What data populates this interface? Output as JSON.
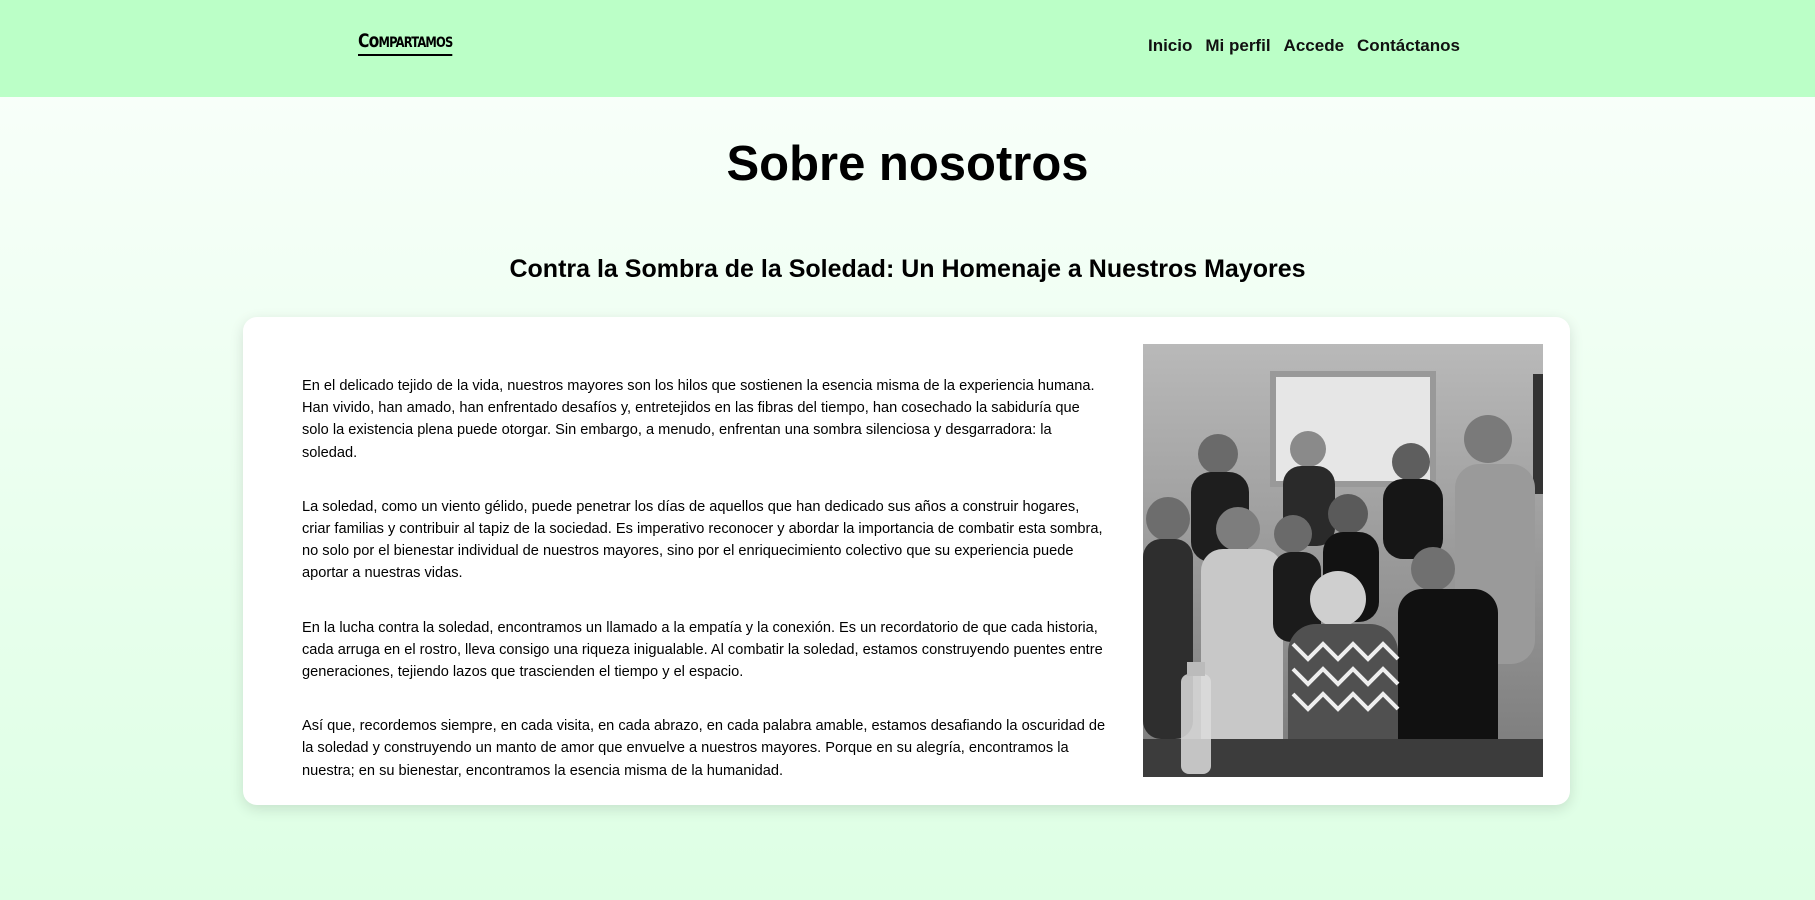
{
  "header": {
    "logo": {
      "big": "Co",
      "rest": "MPARTAMOS"
    },
    "nav": [
      {
        "label": "Inicio"
      },
      {
        "label": "Mi perfil"
      },
      {
        "label": "Accede"
      },
      {
        "label": "Contáctanos"
      }
    ],
    "background": "#bbffc7"
  },
  "main": {
    "title": "Sobre nosotros",
    "subtitle": "Contra la Sombra de la Soledad: Un Homenaje a Nuestros Mayores",
    "paragraphs": [
      "En el delicado tejido de la vida, nuestros mayores son los hilos que sostienen la esencia misma de la experiencia humana. Han vivido, han amado, han enfrentado desafíos y, entretejidos en las fibras del tiempo, han cosechado la sabiduría que solo la existencia plena puede otorgar. Sin embargo, a menudo, enfrentan una sombra silenciosa y desgarradora: la soledad.",
      "La soledad, como un viento gélido, puede penetrar los días de aquellos que han dedicado sus años a construir hogares, criar familias y contribuir al tapiz de la sociedad. Es imperativo reconocer y abordar la importancia de combatir esta sombra, no solo por el bienestar individual de nuestros mayores, sino por el enriquecimiento colectivo que su experiencia puede aportar a nuestras vidas.",
      "En la lucha contra la soledad, encontramos un llamado a la empatía y la conexión. Es un recordatorio de que cada historia, cada arruga en el rostro, lleva consigo una riqueza inigualable. Al combatir la soledad, estamos construyendo puentes entre generaciones, tejiendo lazos que trascienden el tiempo y el espacio.",
      "Así que, recordemos siempre, en cada visita, en cada abrazo, en cada palabra amable, estamos desafiando la oscuridad de la soledad y construyendo un manto de amor que envuelve a nuestros mayores. Porque en su alegría, encontramos la nuestra; en su bienestar, encontramos la esencia misma de la humanidad."
    ],
    "photo_icon": "group-photo-icon"
  }
}
